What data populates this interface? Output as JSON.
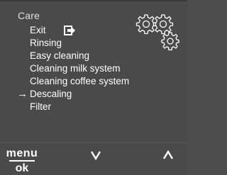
{
  "header": {
    "section_title": "Care"
  },
  "menu": {
    "items": [
      {
        "label": "Exit",
        "icon": "exit-icon",
        "selected": false
      },
      {
        "label": "Rinsing",
        "selected": false
      },
      {
        "label": "Easy cleaning",
        "selected": false
      },
      {
        "label": "Cleaning milk system",
        "selected": false
      },
      {
        "label": "Cleaning coffee system",
        "selected": false
      },
      {
        "label": "Descaling",
        "selected": true
      },
      {
        "label": "Filter",
        "selected": false
      }
    ],
    "selection_marker": "→"
  },
  "decoration": {
    "icon": "gears-icon"
  },
  "softkeys": {
    "menu_label": "menu",
    "ok_label": "ok",
    "down_icon": "chevron-down-icon",
    "up_icon": "chevron-up-icon"
  },
  "colors": {
    "background": "#4a4a4a",
    "text": "#ffffff"
  }
}
